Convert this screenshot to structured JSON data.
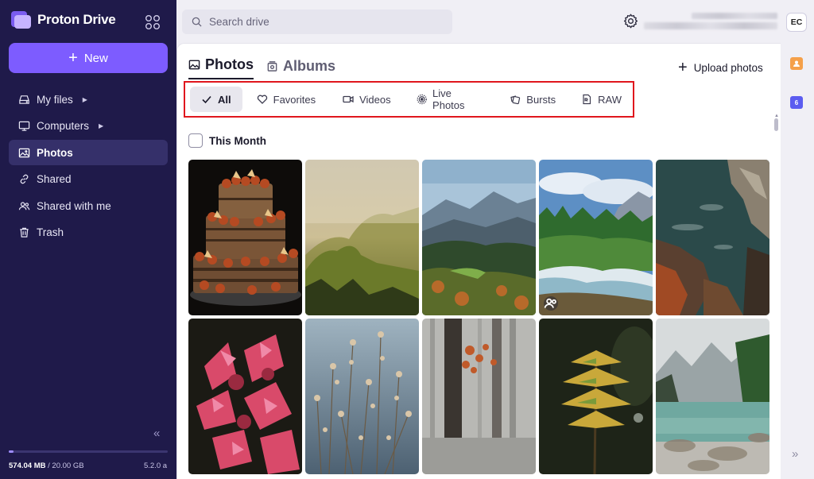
{
  "app": {
    "name": "Proton Drive",
    "version": "5.2.0 a"
  },
  "sidebar": {
    "new_label": "New",
    "items": [
      {
        "label": "My files",
        "has_caret": true
      },
      {
        "label": "Computers",
        "has_caret": true
      },
      {
        "label": "Photos",
        "active": true
      },
      {
        "label": "Shared"
      },
      {
        "label": "Shared with me"
      },
      {
        "label": "Trash"
      }
    ],
    "storage": {
      "used": "574.04 MB",
      "total": "20.00 GB",
      "separator": " / ",
      "fraction": 0.028
    }
  },
  "header": {
    "search_placeholder": "Search drive",
    "user_initials": "EC"
  },
  "main": {
    "tabs": [
      {
        "label": "Photos",
        "active": true
      },
      {
        "label": "Albums"
      }
    ],
    "upload_label": "Upload photos",
    "filters": [
      "All",
      "Favorites",
      "Videos",
      "Live Photos",
      "Bursts",
      "RAW"
    ],
    "active_filter": "All",
    "section_label": "This Month",
    "photos": [
      {
        "subject": "layered-cake"
      },
      {
        "subject": "foggy-mountain-forest"
      },
      {
        "subject": "mountain-valley-autumn"
      },
      {
        "subject": "river-rapids-forest",
        "shared": true
      },
      {
        "subject": "rocky-coast-aerial"
      },
      {
        "subject": "pink-flowers"
      },
      {
        "subject": "dried-wildflowers"
      },
      {
        "subject": "misty-forest-trees"
      },
      {
        "subject": "fern-leaf"
      },
      {
        "subject": "alpine-lake"
      }
    ]
  },
  "rail": {
    "calendar_badge": "6"
  },
  "colors": {
    "sidebar_bg": "#1f1a4a",
    "accent": "#7d5cff",
    "highlight_border": "#e0161d"
  }
}
